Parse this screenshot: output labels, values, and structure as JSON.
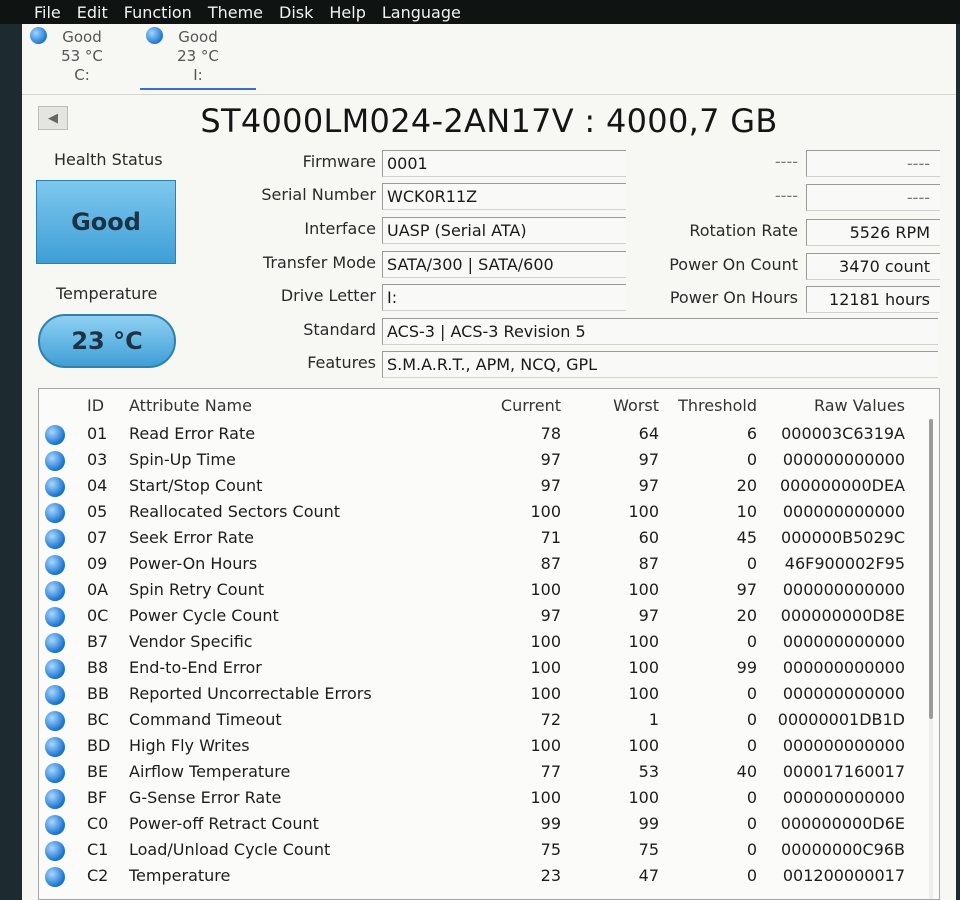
{
  "menu": [
    "File",
    "Edit",
    "Function",
    "Theme",
    "Disk",
    "Help",
    "Language"
  ],
  "disks": [
    {
      "status": "Good",
      "temp": "53 °C",
      "letter": "C:"
    },
    {
      "status": "Good",
      "temp": "23 °C",
      "letter": "I:"
    }
  ],
  "title": "ST4000LM024-2AN17V : 4000,7 GB",
  "health": {
    "label": "Health Status",
    "value": "Good"
  },
  "temperature": {
    "label": "Temperature",
    "value": "23 °C"
  },
  "info": {
    "firmware_label": "Firmware",
    "firmware": "0001",
    "serial_label": "Serial Number",
    "serial": "WCK0R11Z",
    "interface_label": "Interface",
    "interface": "UASP (Serial ATA)",
    "transfer_label": "Transfer Mode",
    "transfer": "SATA/300 | SATA/600",
    "drive_label": "Drive Letter",
    "drive": "I:",
    "standard_label": "Standard",
    "standard": "ACS-3 | ACS-3 Revision 5",
    "features_label": "Features",
    "features": "S.M.A.R.T., APM, NCQ, GPL"
  },
  "right": {
    "blank1_label": "----",
    "blank1": "----",
    "blank2_label": "----",
    "blank2": "----",
    "rotation_label": "Rotation Rate",
    "rotation": "5526 RPM",
    "count_label": "Power On Count",
    "count": "3470 count",
    "hours_label": "Power On Hours",
    "hours": "12181 hours"
  },
  "table": {
    "headers": {
      "id": "ID",
      "name": "Attribute Name",
      "current": "Current",
      "worst": "Worst",
      "threshold": "Threshold",
      "raw": "Raw Values"
    },
    "rows": [
      {
        "id": "01",
        "name": "Read Error Rate",
        "current": "78",
        "worst": "64",
        "threshold": "6",
        "raw": "000003C6319A"
      },
      {
        "id": "03",
        "name": "Spin-Up Time",
        "current": "97",
        "worst": "97",
        "threshold": "0",
        "raw": "000000000000"
      },
      {
        "id": "04",
        "name": "Start/Stop Count",
        "current": "97",
        "worst": "97",
        "threshold": "20",
        "raw": "000000000DEA"
      },
      {
        "id": "05",
        "name": "Reallocated Sectors Count",
        "current": "100",
        "worst": "100",
        "threshold": "10",
        "raw": "000000000000"
      },
      {
        "id": "07",
        "name": "Seek Error Rate",
        "current": "71",
        "worst": "60",
        "threshold": "45",
        "raw": "000000B5029C"
      },
      {
        "id": "09",
        "name": "Power-On Hours",
        "current": "87",
        "worst": "87",
        "threshold": "0",
        "raw": "46F900002F95"
      },
      {
        "id": "0A",
        "name": "Spin Retry Count",
        "current": "100",
        "worst": "100",
        "threshold": "97",
        "raw": "000000000000"
      },
      {
        "id": "0C",
        "name": "Power Cycle Count",
        "current": "97",
        "worst": "97",
        "threshold": "20",
        "raw": "000000000D8E"
      },
      {
        "id": "B7",
        "name": "Vendor Specific",
        "current": "100",
        "worst": "100",
        "threshold": "0",
        "raw": "000000000000"
      },
      {
        "id": "B8",
        "name": "End-to-End Error",
        "current": "100",
        "worst": "100",
        "threshold": "99",
        "raw": "000000000000"
      },
      {
        "id": "BB",
        "name": "Reported Uncorrectable Errors",
        "current": "100",
        "worst": "100",
        "threshold": "0",
        "raw": "000000000000"
      },
      {
        "id": "BC",
        "name": "Command Timeout",
        "current": "72",
        "worst": "1",
        "threshold": "0",
        "raw": "00000001DB1D"
      },
      {
        "id": "BD",
        "name": "High Fly Writes",
        "current": "100",
        "worst": "100",
        "threshold": "0",
        "raw": "000000000000"
      },
      {
        "id": "BE",
        "name": "Airflow Temperature",
        "current": "77",
        "worst": "53",
        "threshold": "40",
        "raw": "000017160017"
      },
      {
        "id": "BF",
        "name": "G-Sense Error Rate",
        "current": "100",
        "worst": "100",
        "threshold": "0",
        "raw": "000000000000"
      },
      {
        "id": "C0",
        "name": "Power-off Retract Count",
        "current": "99",
        "worst": "99",
        "threshold": "0",
        "raw": "000000000D6E"
      },
      {
        "id": "C1",
        "name": "Load/Unload Cycle Count",
        "current": "75",
        "worst": "75",
        "threshold": "0",
        "raw": "00000000C96B"
      },
      {
        "id": "C2",
        "name": "Temperature",
        "current": "23",
        "worst": "47",
        "threshold": "0",
        "raw": "001200000017"
      }
    ]
  },
  "colors": {
    "status_good": "#3e9fd6",
    "accent": "#3a6fd0"
  }
}
